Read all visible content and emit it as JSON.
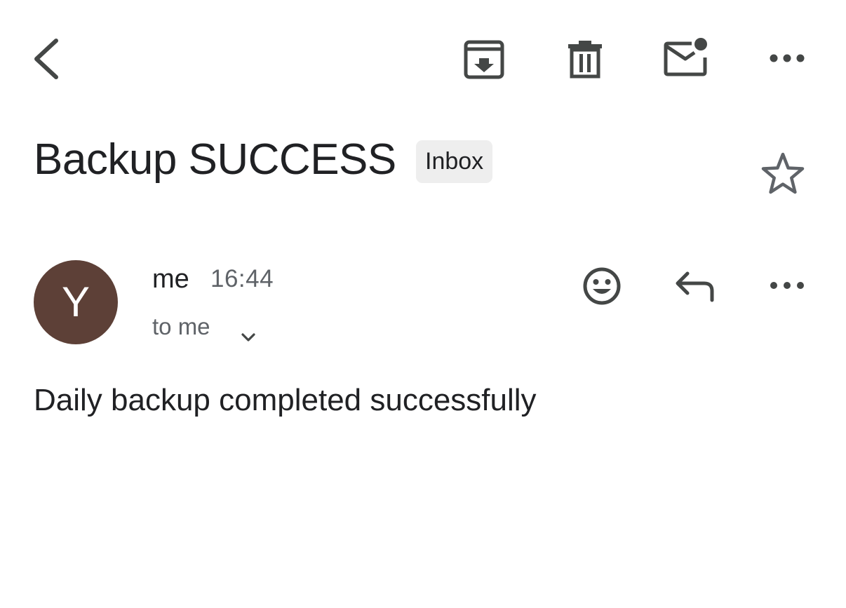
{
  "toolbar": {
    "back_icon": "arrow-back-icon",
    "archive_icon": "archive-icon",
    "delete_icon": "trash-icon",
    "mark_unread_icon": "mark-unread-icon",
    "more_icon": "more-horizontal-icon"
  },
  "email": {
    "subject": "Backup SUCCESS",
    "label": "Inbox",
    "starred": false,
    "sender": {
      "avatar_initial": "Y",
      "avatar_color": "#5d4037",
      "name": "me",
      "time": "16:44",
      "recipients": "to me"
    },
    "body": "Daily backup completed successfully"
  },
  "colors": {
    "text_primary": "#202124",
    "text_secondary": "#5f6368",
    "icon": "#444746",
    "chip_background": "#eeeeee"
  }
}
